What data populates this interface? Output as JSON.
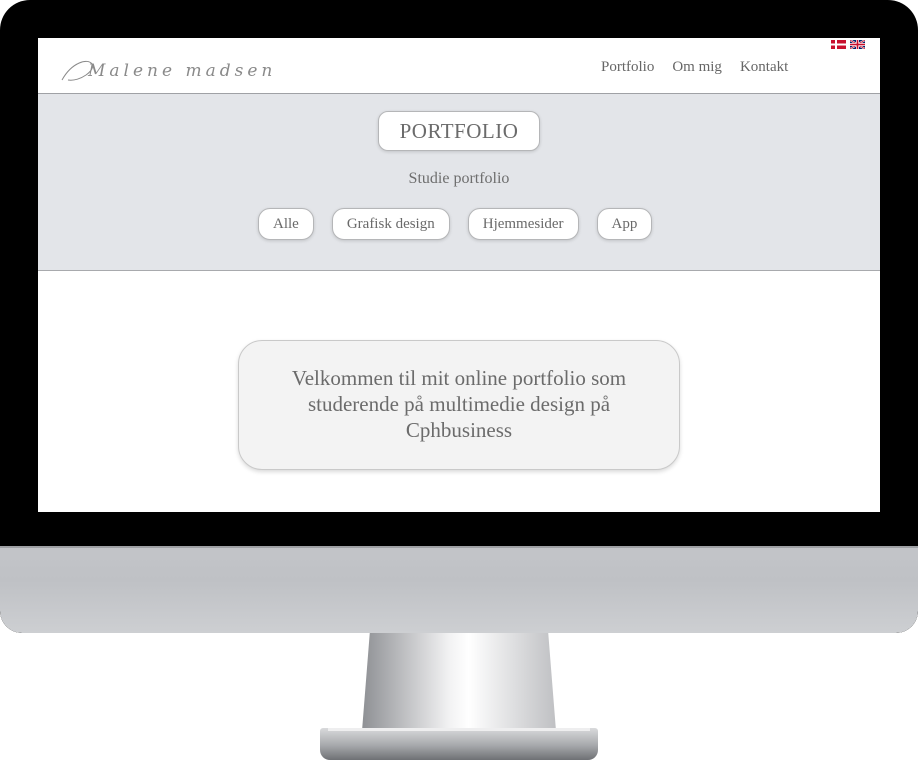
{
  "site": {
    "logo_text": "Malene madsen"
  },
  "nav": {
    "items": [
      {
        "label": "Portfolio"
      },
      {
        "label": "Om mig"
      },
      {
        "label": "Kontakt"
      }
    ]
  },
  "languages": [
    {
      "code": "da",
      "icon": "danish-flag-icon"
    },
    {
      "code": "en",
      "icon": "uk-flag-icon"
    }
  ],
  "hero": {
    "title": "PORTFOLIO",
    "subtitle": "Studie portfolio",
    "filters": [
      {
        "label": "Alle"
      },
      {
        "label": "Grafisk design"
      },
      {
        "label": "Hjemmesider"
      },
      {
        "label": "App"
      }
    ]
  },
  "welcome": {
    "text": "Velkommen til mit online portfolio som studerende på multimedie design på Cphbusiness"
  },
  "colors": {
    "hero_bg": "#e3e5e9",
    "text": "#6b6b6b",
    "danish_red": "#c8102e",
    "uk_blue": "#012169"
  }
}
